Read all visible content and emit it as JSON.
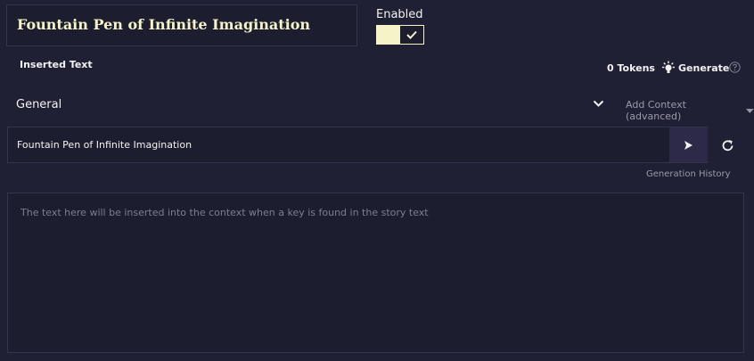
{
  "entry": {
    "title": "Fountain Pen of Infinite Imagination"
  },
  "enabled": {
    "label": "Enabled",
    "state": true
  },
  "inserted_text": {
    "label": "Inserted Text",
    "tokens": "0 Tokens",
    "generate_label": "Generate"
  },
  "context": {
    "category": "General",
    "add_context_label": "Add Context (advanced)"
  },
  "generation": {
    "input_value": "Fountain Pen of Infinite Imagination",
    "history_label": "Generation History"
  },
  "body": {
    "placeholder": "The text here will be inserted into the context when a key is found in the story text"
  },
  "colors": {
    "background": "#1f2033",
    "panel": "#1c1d2e",
    "accent": "#f5f3c7",
    "muted": "#9a9aa8"
  }
}
